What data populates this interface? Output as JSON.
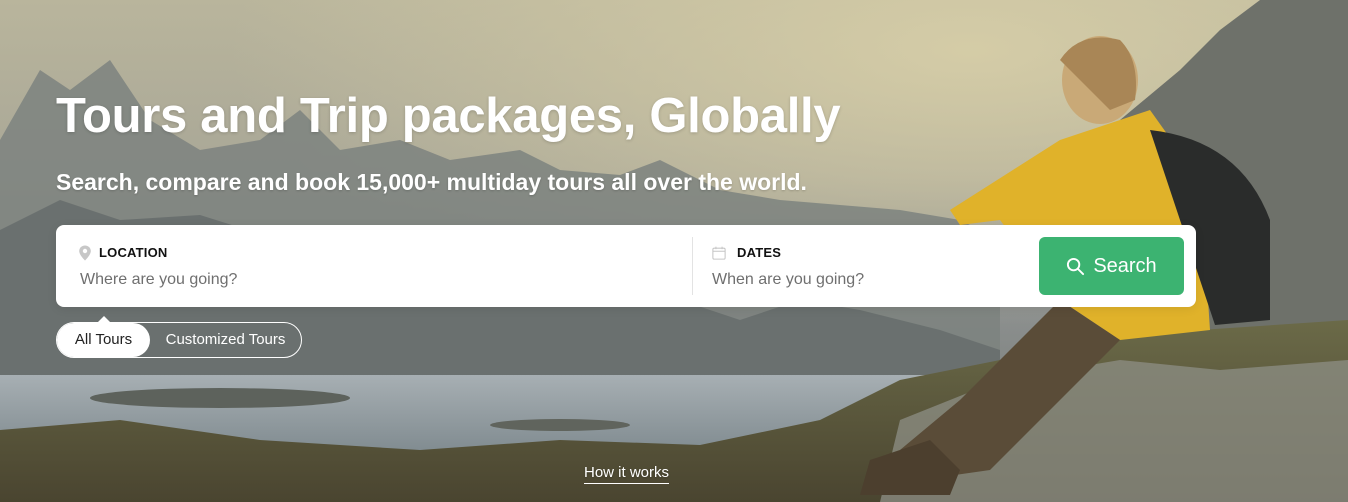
{
  "hero": {
    "title": "Tours and Trip packages, Globally",
    "subtitle": "Search, compare and book 15,000+ multiday tours all over the world."
  },
  "search": {
    "location": {
      "label": "LOCATION",
      "placeholder": "Where are you going?",
      "icon": "map-pin-icon"
    },
    "dates": {
      "label": "DATES",
      "placeholder": "When are you going?",
      "icon": "calendar-icon"
    },
    "button": {
      "label": "Search",
      "icon": "search-icon"
    }
  },
  "tour_types": {
    "tabs": [
      "All Tours",
      "Customized Tours"
    ],
    "selected": "All Tours"
  },
  "how_it_works": "How it works",
  "colors": {
    "accent": "#3cb371",
    "text_on_image": "#ffffff",
    "field_label": "#111111",
    "placeholder": "#6f6f6f"
  }
}
